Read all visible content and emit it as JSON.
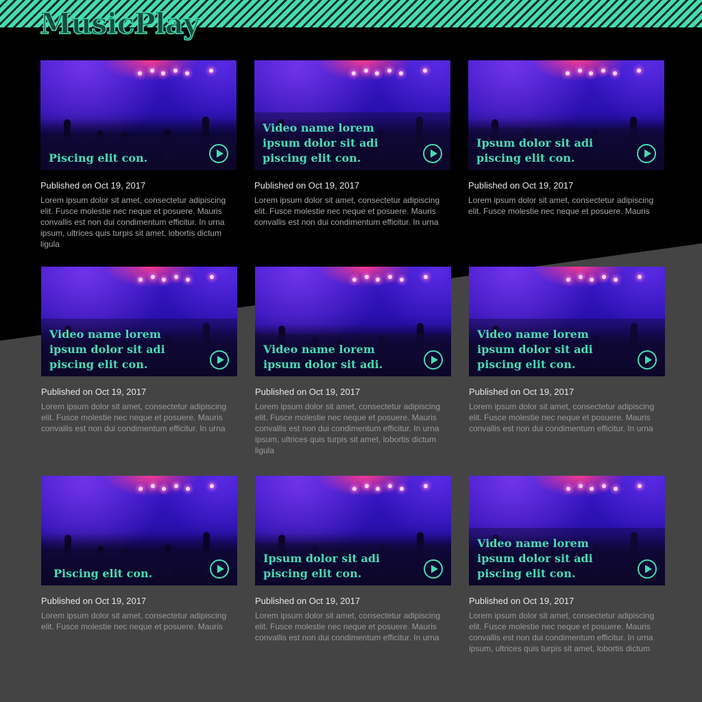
{
  "brand": {
    "logo": "MusicPlay"
  },
  "colors": {
    "accent": "#47dcb3",
    "dark_bg": "#000000",
    "grey_bg": "#444444"
  },
  "videos": [
    {
      "title": "Piscing elit con.",
      "date": "Published on Oct 19, 2017",
      "description": "Lorem ipsum dolor sit amet, consectetur adipiscing elit. Fusce molestie nec neque et posuere. Mauris convallis est non dui condimentum efficitur. In urna ipsum, ultrices quis turpis sit amet, lobortis dictum ligula"
    },
    {
      "title": "Video name lorem ipsum dolor sit adi piscing elit con.",
      "date": "Published on Oct 19, 2017",
      "description": "Lorem ipsum dolor sit amet, consectetur adipiscing elit. Fusce molestie nec neque et posuere. Mauris convallis est non dui condimentum efficitur. In urna"
    },
    {
      "title": "Ipsum dolor sit adi piscing elit con.",
      "date": "Published on Oct 19, 2017",
      "description": "Lorem ipsum dolor sit amet, consectetur adipiscing elit. Fusce molestie nec neque et posuere. Mauris"
    },
    {
      "title": "Video name lorem ipsum dolor sit adi piscing elit con.",
      "date": "Published on Oct 19, 2017",
      "description": "Lorem ipsum dolor sit amet, consectetur adipiscing elit. Fusce molestie nec neque et posuere. Mauris convallis est non dui condimentum efficitur. In urna"
    },
    {
      "title": "Video name lorem ipsum dolor sit adi.",
      "date": "Published on Oct 19, 2017",
      "description": "Lorem ipsum dolor sit amet, consectetur adipiscing elit. Fusce molestie nec neque et posuere. Mauris convallis est non dui condimentum efficitur. In urna ipsum, ultrices quis turpis sit amet, lobortis dictum ligula"
    },
    {
      "title": "Video name lorem ipsum dolor sit adi piscing elit con.",
      "date": "Published on Oct 19, 2017",
      "description": "Lorem ipsum dolor sit amet, consectetur adipiscing elit. Fusce molestie nec neque et posuere. Mauris convallis est non dui condimentum efficitur. In urna"
    },
    {
      "title": "Piscing elit con.",
      "date": "Published on Oct 19, 2017",
      "description": "Lorem ipsum dolor sit amet, consectetur adipiscing elit. Fusce molestie nec neque et posuere. Mauris"
    },
    {
      "title": "Ipsum dolor sit adi piscing elit con.",
      "date": "Published on Oct 19, 2017",
      "description": "Lorem ipsum dolor sit amet, consectetur adipiscing elit. Fusce molestie nec neque et posuere. Mauris convallis est non dui condimentum efficitur. In urna"
    },
    {
      "title": "Video name lorem ipsum dolor sit adi piscing elit con.",
      "date": "Published on Oct 19, 2017",
      "description": "Lorem ipsum dolor sit amet, consectetur adipiscing elit. Fusce molestie nec neque et posuere. Mauris convallis est non dui condimentum efficitur. In urna ipsum, ultrices quis turpis sit amet, lobortis dictum"
    }
  ]
}
